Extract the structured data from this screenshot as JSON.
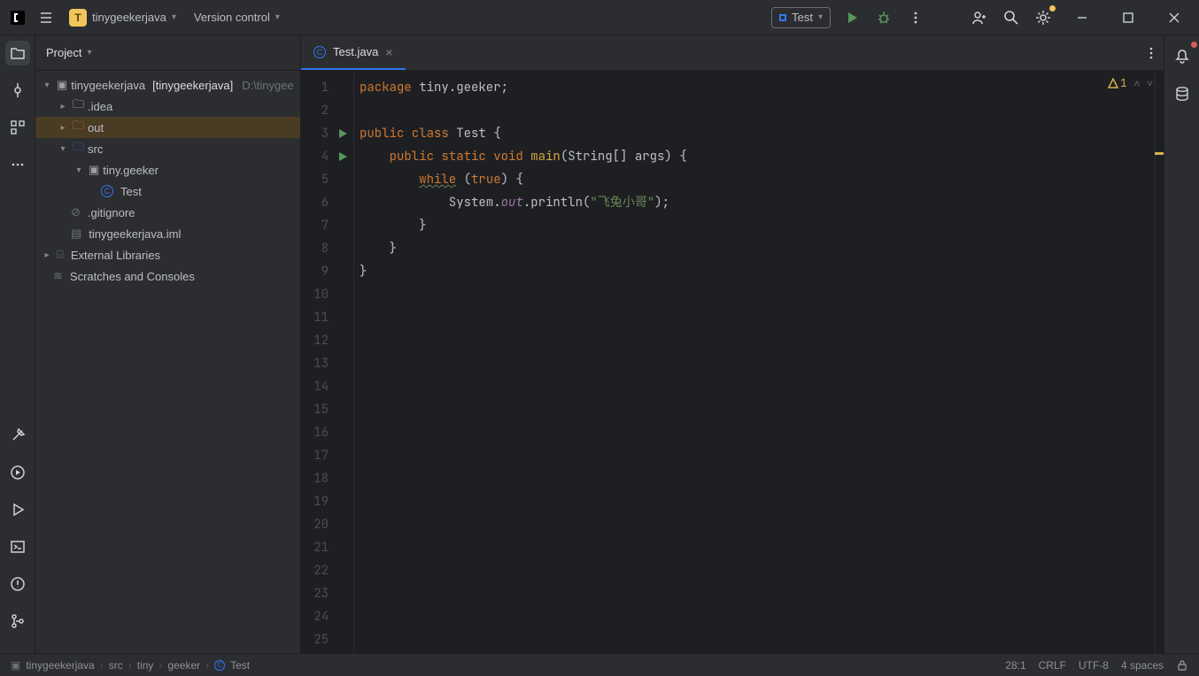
{
  "titlebar": {
    "project_letter": "T",
    "project_name": "tinygeekerjava",
    "vcs_label": "Version control",
    "run_config": "Test"
  },
  "sidebar": {
    "title": "Project",
    "root": {
      "name": "tinygeekerjava",
      "bracket": "[tinygeekerjava]",
      "path": "D:\\tinygee"
    },
    "idea": ".idea",
    "out": "out",
    "src": "src",
    "package": "tiny.geeker",
    "test_class": "Test",
    "gitignore": ".gitignore",
    "iml": "tinygeekerjava.iml",
    "external": "External Libraries",
    "scratches": "Scratches and Consoles"
  },
  "tabs": {
    "file": "Test.java"
  },
  "editor": {
    "warning_count": "1",
    "lines": [
      {
        "n": "1",
        "type": "code",
        "html": "<span class='kw'>package</span> tiny.geeker;"
      },
      {
        "n": "2",
        "type": "blank",
        "html": ""
      },
      {
        "n": "3",
        "type": "code",
        "play": true,
        "html": "<span class='kw'>public class</span> <span class='type'>Test</span> {"
      },
      {
        "n": "4",
        "type": "code",
        "play": true,
        "html": "    <span class='kw'>public static void</span> <span class='fn'>main</span>(String[] args) {"
      },
      {
        "n": "5",
        "type": "code",
        "html": "        <span class='kw while'>while</span> (<span class='kw'>true</span>) {"
      },
      {
        "n": "6",
        "type": "code",
        "html": "            System.<span class='field'>out</span>.println(<span class='str'>\"飞兔小哥\"</span>);"
      },
      {
        "n": "7",
        "type": "code",
        "html": "        }"
      },
      {
        "n": "8",
        "type": "code",
        "html": "    }"
      },
      {
        "n": "9",
        "type": "code",
        "html": "}"
      },
      {
        "n": "10"
      },
      {
        "n": "11"
      },
      {
        "n": "12"
      },
      {
        "n": "13"
      },
      {
        "n": "14"
      },
      {
        "n": "15"
      },
      {
        "n": "16"
      },
      {
        "n": "17"
      },
      {
        "n": "18"
      },
      {
        "n": "19"
      },
      {
        "n": "20"
      },
      {
        "n": "21"
      },
      {
        "n": "22"
      },
      {
        "n": "23"
      },
      {
        "n": "24"
      },
      {
        "n": "25"
      }
    ]
  },
  "breadcrumb": {
    "root": "tinygeekerjava",
    "src": "src",
    "p1": "tiny",
    "p2": "geeker",
    "cls": "Test"
  },
  "status": {
    "pos": "28:1",
    "eol": "CRLF",
    "enc": "UTF-8",
    "indent": "4 spaces"
  }
}
